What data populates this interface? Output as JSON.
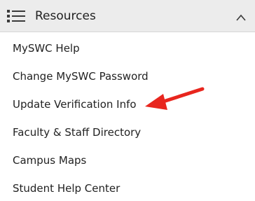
{
  "header": {
    "title": "Resources",
    "icon": "list-icon",
    "toggle_icon": "chevron-up-icon",
    "expanded": true
  },
  "links": [
    {
      "label": "MySWC Help"
    },
    {
      "label": "Change MySWC Password"
    },
    {
      "label": "Update Verification Info"
    },
    {
      "label": "Faculty & Staff Directory"
    },
    {
      "label": "Campus Maps"
    },
    {
      "label": "Student Help Center"
    }
  ],
  "annotation": {
    "icon": "red-arrow-icon",
    "color": "#e8261e",
    "points_to": "Update Verification Info"
  },
  "colors": {
    "header_bg": "#ececec",
    "text": "#222222",
    "icon": "#3a3a3a"
  }
}
